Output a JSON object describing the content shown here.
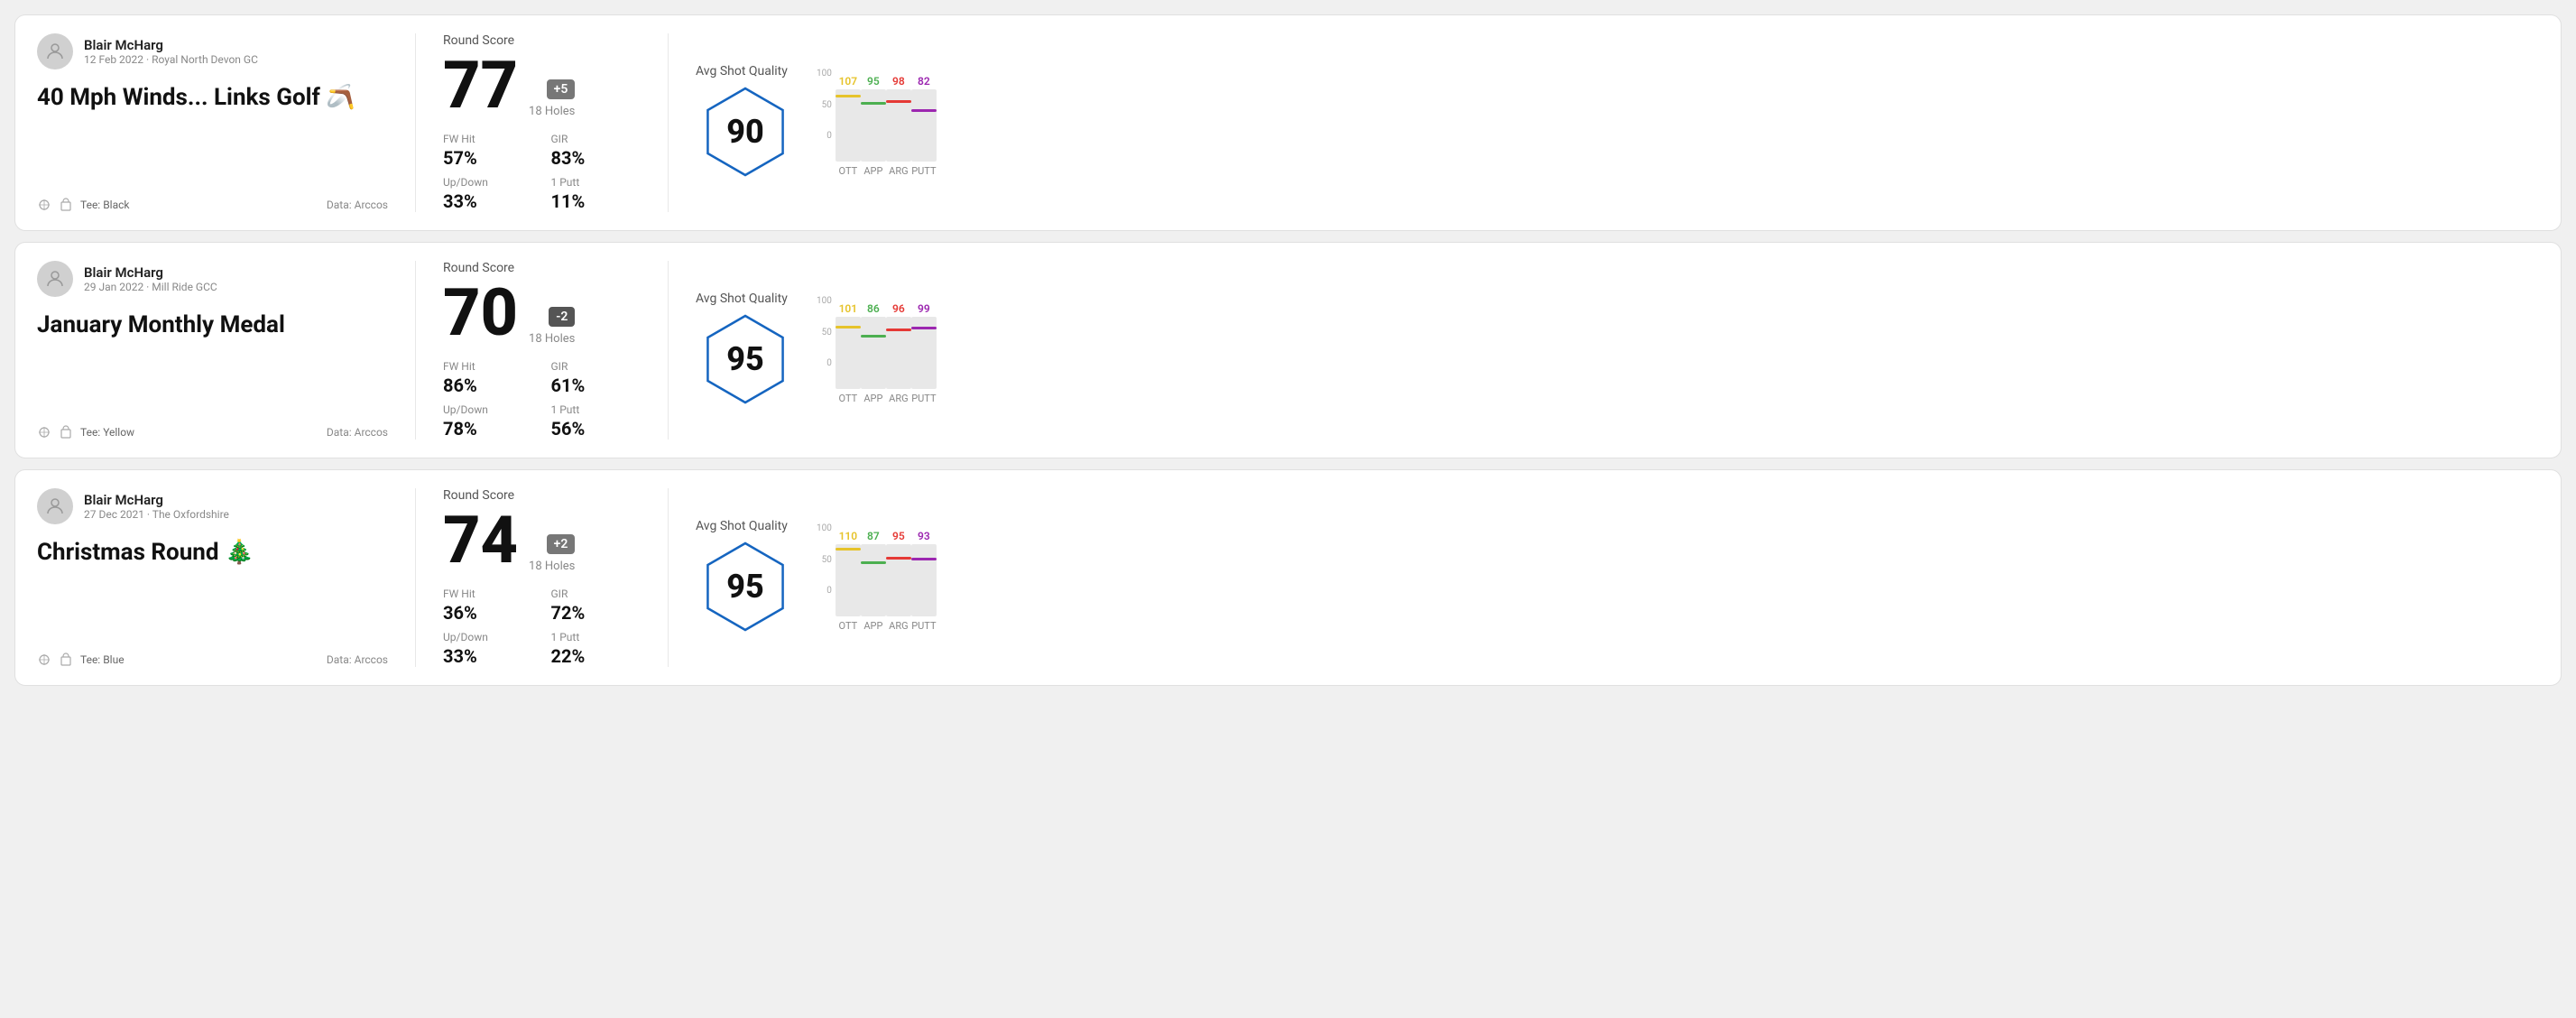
{
  "rounds": [
    {
      "id": "round-1",
      "user": {
        "name": "Blair McHarg",
        "meta": "12 Feb 2022 · Royal North Devon GC"
      },
      "title": "40 Mph Winds... Links Golf 🪃",
      "tee": "Black",
      "data_source": "Data: Arccos",
      "score": {
        "label": "Round Score",
        "number": "77",
        "badge": "+5",
        "badge_type": "positive",
        "holes": "18 Holes"
      },
      "stats": [
        {
          "label": "FW Hit",
          "value": "57%"
        },
        {
          "label": "GIR",
          "value": "83%"
        },
        {
          "label": "Up/Down",
          "value": "33%"
        },
        {
          "label": "1 Putt",
          "value": "11%"
        }
      ],
      "quality": {
        "label": "Avg Shot Quality",
        "score": "90"
      },
      "chart": {
        "bars": [
          {
            "label": "OTT",
            "value": 107,
            "color": "#e6c32a"
          },
          {
            "label": "APP",
            "value": 95,
            "color": "#4caf50"
          },
          {
            "label": "ARG",
            "value": 98,
            "color": "#e53935"
          },
          {
            "label": "PUTT",
            "value": 82,
            "color": "#9c27b0"
          }
        ],
        "y_labels": [
          "100",
          "50",
          "0"
        ]
      }
    },
    {
      "id": "round-2",
      "user": {
        "name": "Blair McHarg",
        "meta": "29 Jan 2022 · Mill Ride GCC"
      },
      "title": "January Monthly Medal",
      "tee": "Yellow",
      "data_source": "Data: Arccos",
      "score": {
        "label": "Round Score",
        "number": "70",
        "badge": "-2",
        "badge_type": "negative",
        "holes": "18 Holes"
      },
      "stats": [
        {
          "label": "FW Hit",
          "value": "86%"
        },
        {
          "label": "GIR",
          "value": "61%"
        },
        {
          "label": "Up/Down",
          "value": "78%"
        },
        {
          "label": "1 Putt",
          "value": "56%"
        }
      ],
      "quality": {
        "label": "Avg Shot Quality",
        "score": "95"
      },
      "chart": {
        "bars": [
          {
            "label": "OTT",
            "value": 101,
            "color": "#e6c32a"
          },
          {
            "label": "APP",
            "value": 86,
            "color": "#4caf50"
          },
          {
            "label": "ARG",
            "value": 96,
            "color": "#e53935"
          },
          {
            "label": "PUTT",
            "value": 99,
            "color": "#9c27b0"
          }
        ],
        "y_labels": [
          "100",
          "50",
          "0"
        ]
      }
    },
    {
      "id": "round-3",
      "user": {
        "name": "Blair McHarg",
        "meta": "27 Dec 2021 · The Oxfordshire"
      },
      "title": "Christmas Round 🎄",
      "tee": "Blue",
      "data_source": "Data: Arccos",
      "score": {
        "label": "Round Score",
        "number": "74",
        "badge": "+2",
        "badge_type": "positive",
        "holes": "18 Holes"
      },
      "stats": [
        {
          "label": "FW Hit",
          "value": "36%"
        },
        {
          "label": "GIR",
          "value": "72%"
        },
        {
          "label": "Up/Down",
          "value": "33%"
        },
        {
          "label": "1 Putt",
          "value": "22%"
        }
      ],
      "quality": {
        "label": "Avg Shot Quality",
        "score": "95"
      },
      "chart": {
        "bars": [
          {
            "label": "OTT",
            "value": 110,
            "color": "#e6c32a"
          },
          {
            "label": "APP",
            "value": 87,
            "color": "#4caf50"
          },
          {
            "label": "ARG",
            "value": 95,
            "color": "#e53935"
          },
          {
            "label": "PUTT",
            "value": 93,
            "color": "#9c27b0"
          }
        ],
        "y_labels": [
          "100",
          "50",
          "0"
        ]
      }
    }
  ]
}
